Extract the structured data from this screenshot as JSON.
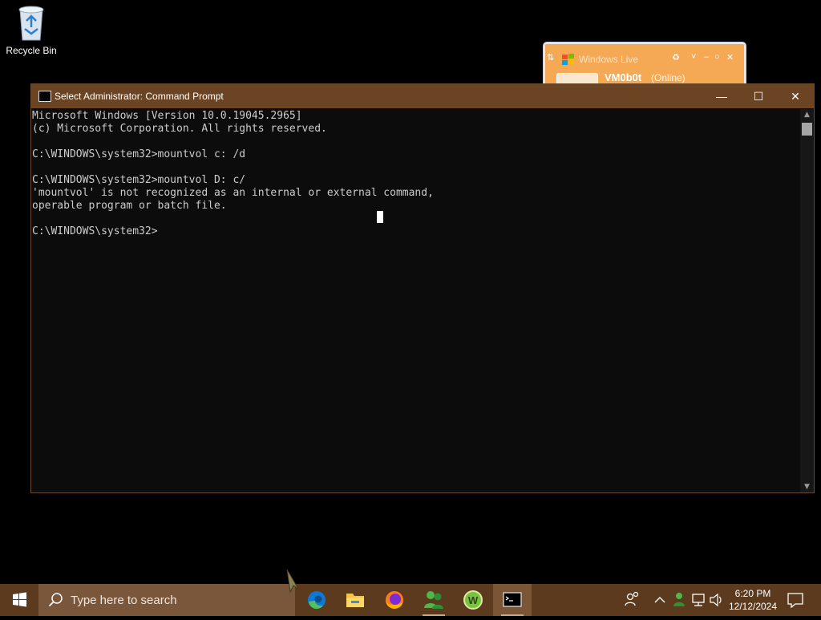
{
  "desktop": {
    "recycle_bin_label": "Recycle Bin"
  },
  "messenger_widget": {
    "title": "Windows Live ",
    "contact_name": "VM0b0t",
    "status": "(Online)",
    "colors": {
      "background": "#f6a955"
    }
  },
  "cmd_window": {
    "title": "Select Administrator: Command Prompt",
    "minimize_glyph": "—",
    "maximize_glyph": "☐",
    "close_glyph": "✕",
    "console_lines": [
      "Microsoft Windows [Version 10.0.19045.2965]",
      "(c) Microsoft Corporation. All rights reserved.",
      "",
      "C:\\WINDOWS\\system32>mountvol c: /d",
      "",
      "C:\\WINDOWS\\system32>mountvol D: c/",
      "'mountvol' is not recognized as an internal or external command,",
      "operable program or batch file.",
      "",
      "C:\\WINDOWS\\system32>"
    ],
    "colors": {
      "titlebar": "#6b4423",
      "console_bg": "#0c0c0c",
      "console_text": "#cccccc"
    }
  },
  "taskbar": {
    "search_placeholder": "Type here to search",
    "pinned": [
      {
        "name": "edge-icon"
      },
      {
        "name": "file-explorer-icon"
      },
      {
        "name": "firefox-icon"
      },
      {
        "name": "messenger-icon"
      },
      {
        "name": "w-app-icon"
      },
      {
        "name": "command-prompt-icon",
        "active": true
      }
    ],
    "clock": {
      "time": "6:20 PM",
      "date": "12/12/2024"
    },
    "colors": {
      "background": "#5b3a1d",
      "search_bg": "#7a563a"
    }
  }
}
